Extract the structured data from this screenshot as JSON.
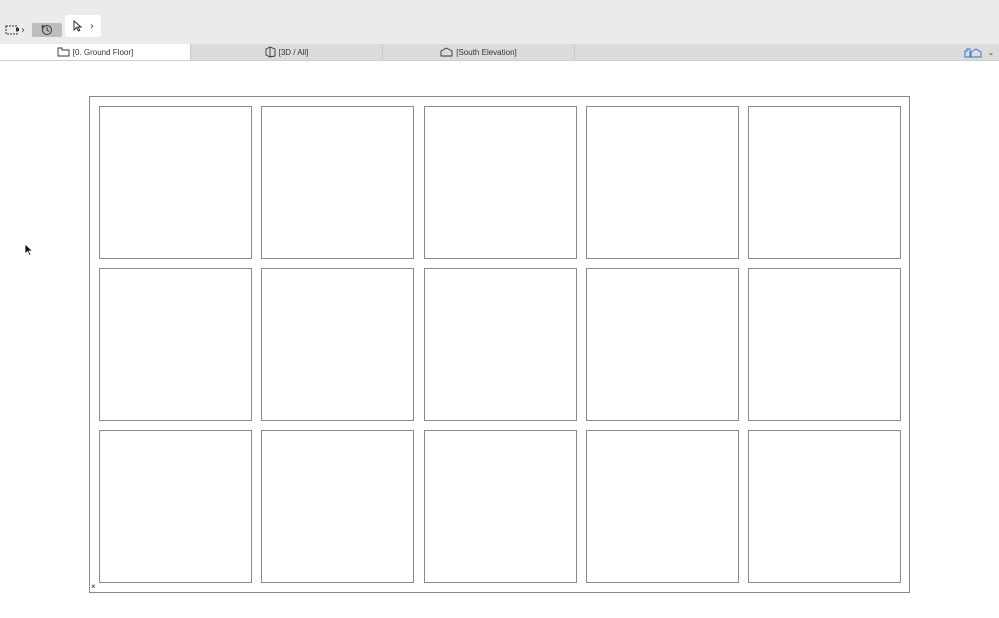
{
  "toolbar": {
    "buttons": [
      {
        "name": "marquee-tool-button",
        "icon": "marquee-icon"
      },
      {
        "name": "orbit-tool-button",
        "icon": "orbit-icon"
      },
      {
        "name": "arrow-tool-button",
        "icon": "arrow-pointer-icon"
      }
    ]
  },
  "tabs": [
    {
      "label": "[0. Ground Floor]",
      "icon": "floor-plan-icon",
      "active": true
    },
    {
      "label": "[3D / All]",
      "icon": "3d-box-icon",
      "active": false
    },
    {
      "label": "[South Elevation]",
      "icon": "elevation-house-icon",
      "active": false
    }
  ],
  "view_switcher": {
    "icon": "navigator-view-icon"
  },
  "sheet": {
    "rows": 3,
    "columns": 5,
    "origin_marker": "×"
  },
  "colors": {
    "toolbar_bg": "#ebebe9",
    "tab_bg": "#dcdcda",
    "active_tab_bg": "#ffffff",
    "line": "#8a8a8a",
    "accent": "#2f6fd6"
  }
}
